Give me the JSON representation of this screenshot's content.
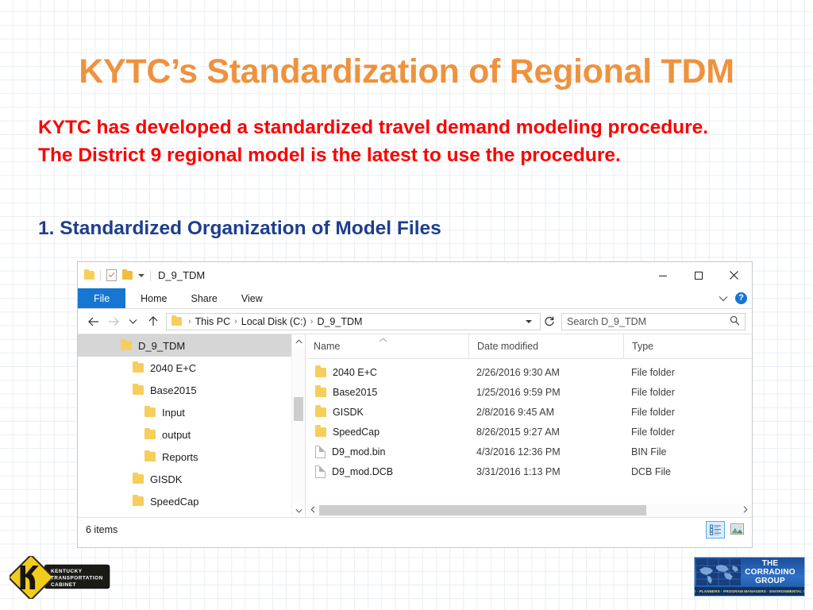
{
  "slide": {
    "title": "KYTC’s Standardization of Regional TDM",
    "body_text": "KYTC has developed a standardized travel demand modeling procedure. The District 9 regional model is the latest to use the procedure.",
    "section_heading": "1. Standardized Organization of Model Files",
    "colors": {
      "title": "#EE923E",
      "body": "#FA0000",
      "heading": "#1F3E8C",
      "accent_blue": "#1577D1"
    }
  },
  "explorer": {
    "window_title": "D_9_TDM",
    "quick_access": [
      "folder-icon",
      "properties-icon",
      "new-folder-icon",
      "customize-caret"
    ],
    "window_controls": {
      "minimize": "–",
      "maximize": "□",
      "close": "✕"
    },
    "ribbon_tabs": [
      {
        "label": "File",
        "active": true
      },
      {
        "label": "Home",
        "active": false
      },
      {
        "label": "Share",
        "active": false
      },
      {
        "label": "View",
        "active": false
      }
    ],
    "ribbon_help": "?",
    "address": {
      "breadcrumbs": [
        "This PC",
        "Local Disk (C:)",
        "D_9_TDM"
      ],
      "separator": "›"
    },
    "search": {
      "placeholder": "Search D_9_TDM",
      "value": ""
    },
    "nav_tree": [
      {
        "label": "D_9_TDM",
        "indent": 0,
        "selected": true
      },
      {
        "label": "2040 E+C",
        "indent": 1,
        "selected": false
      },
      {
        "label": "Base2015",
        "indent": 1,
        "selected": false
      },
      {
        "label": "Input",
        "indent": 2,
        "selected": false
      },
      {
        "label": "output",
        "indent": 2,
        "selected": false
      },
      {
        "label": "Reports",
        "indent": 2,
        "selected": false
      },
      {
        "label": "GISDK",
        "indent": 1,
        "selected": false
      },
      {
        "label": "SpeedCap",
        "indent": 1,
        "selected": false
      }
    ],
    "columns": [
      "Name",
      "Date modified",
      "Type"
    ],
    "sort_column": "Name",
    "sort_direction": "ascending",
    "files": [
      {
        "name": "2040 E+C",
        "date": "2/26/2016 9:30 AM",
        "type": "File folder",
        "kind": "folder"
      },
      {
        "name": "Base2015",
        "date": "1/25/2016 9:59 PM",
        "type": "File folder",
        "kind": "folder"
      },
      {
        "name": "GISDK",
        "date": "2/8/2016 9:45 AM",
        "type": "File folder",
        "kind": "folder"
      },
      {
        "name": "SpeedCap",
        "date": "8/26/2015 9:27 AM",
        "type": "File folder",
        "kind": "folder"
      },
      {
        "name": "D9_mod.bin",
        "date": "4/3/2016 12:36 PM",
        "type": "BIN File",
        "kind": "file"
      },
      {
        "name": "D9_mod.DCB",
        "date": "3/31/2016 1:13 PM",
        "type": "DCB File",
        "kind": "file"
      }
    ],
    "status": {
      "item_count": "6 items"
    },
    "view_buttons": [
      {
        "name": "details-view",
        "active": true
      },
      {
        "name": "large-icons-view",
        "active": false
      }
    ]
  },
  "logos": {
    "kytc": {
      "mark": "K",
      "line1": "KENTUCKY",
      "line2": "TRANSPORTATION",
      "line3": "CABINET"
    },
    "corradino": {
      "line1": "THE",
      "line2": "CORRADINO",
      "line3": "GROUP",
      "tagline": "ENGINEERS · PLANNERS · PROGRAM MANAGERS · ENVIRONMENTAL SCIENTISTS"
    }
  }
}
